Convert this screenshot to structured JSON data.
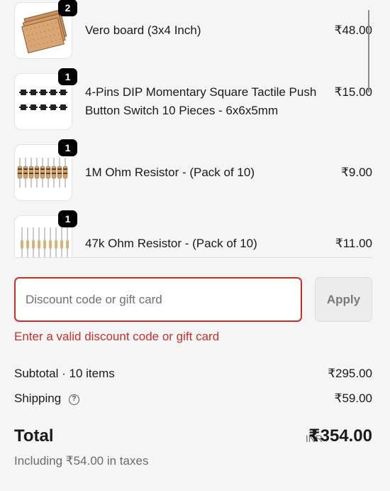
{
  "line_items": [
    {
      "qty": "2",
      "name": "Vero board (3x4 Inch)",
      "price": "₹48.00",
      "thumbnail": "vero-board-thumbnail"
    },
    {
      "qty": "1",
      "name": "4-Pins DIP Momentary Square Tactile Push Button Switch 10 Pieces - 6x6x5mm",
      "price": "₹15.00",
      "thumbnail": "tactile-switch-thumbnail"
    },
    {
      "qty": "1",
      "name": "1M Ohm Resistor - (Pack of 10)",
      "price": "₹9.00",
      "thumbnail": "resistor-pack-thumbnail"
    },
    {
      "qty": "1",
      "name": "47k Ohm Resistor - (Pack of 10)",
      "price": "₹11.00",
      "thumbnail": "resistor-pack-thumbnail"
    }
  ],
  "discount": {
    "placeholder": "Discount code or gift card",
    "value": "",
    "apply_label": "Apply",
    "error": "Enter a valid discount code or gift card"
  },
  "summary": {
    "subtotal_label": "Subtotal · 10 items",
    "subtotal_value": "₹295.00",
    "shipping_label": "Shipping",
    "shipping_help_icon": "?",
    "shipping_value": "₹59.00",
    "total_label": "Total",
    "currency": "INR",
    "total_value": "₹354.00",
    "tax_note": "Including ₹54.00 in taxes"
  },
  "colors": {
    "background": "#f5f5f5",
    "error": "#c9302c",
    "badge": "#000000"
  }
}
